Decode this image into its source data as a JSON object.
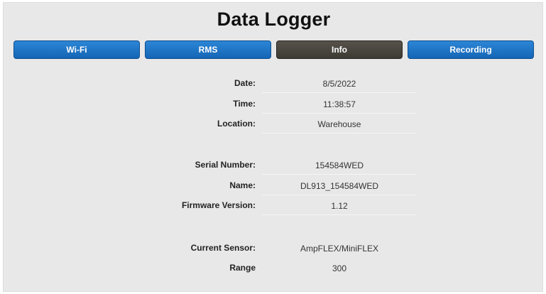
{
  "title": "Data Logger",
  "tabs": [
    {
      "label": "Wi-Fi",
      "active": false
    },
    {
      "label": "RMS",
      "active": false
    },
    {
      "label": "Info",
      "active": true
    },
    {
      "label": "Recording",
      "active": false
    }
  ],
  "info": {
    "date": {
      "label": "Date:",
      "value": "8/5/2022"
    },
    "time": {
      "label": "Time:",
      "value": "11:38:57"
    },
    "location": {
      "label": "Location:",
      "value": "Warehouse"
    },
    "serial": {
      "label": "Serial Number:",
      "value": "154584WED"
    },
    "name": {
      "label": "Name:",
      "value": "DL913_154584WED"
    },
    "firmware": {
      "label": "Firmware Version:",
      "value": "1.12"
    },
    "sensor": {
      "label": "Current Sensor:",
      "value": "AmpFLEX/MiniFLEX"
    },
    "range": {
      "label": "Range",
      "value": "300"
    }
  },
  "colors": {
    "tab_blue": "#1d74c6",
    "tab_active": "#4a463f",
    "panel_bg": "#e8e8e8"
  }
}
